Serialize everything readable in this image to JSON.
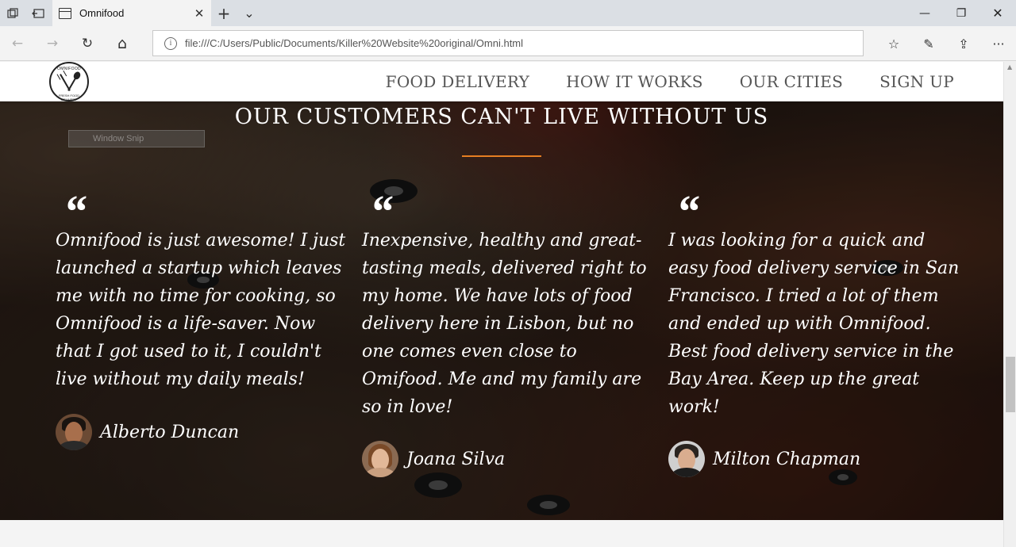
{
  "browser": {
    "tab_title": "Omnifood",
    "url": "file:///C:/Users/Public/Documents/Killer%20Website%20original/Omni.html",
    "icons": {
      "tab_actions": "tab-actions-icon",
      "set_aside": "set-aside-tabs-icon",
      "new_tab": "+",
      "tab_list": "⌄",
      "close_tab": "✕",
      "minimize": "—",
      "restore": "❐",
      "close_window": "✕",
      "back": "←",
      "forward": "→",
      "refresh": "↻",
      "home": "⌂",
      "info": "i",
      "favorites": "☆",
      "notes": "✎",
      "share": "⇪",
      "more": "···"
    }
  },
  "nav": {
    "logo_label": "OMNIFOOD",
    "logo_sub": "FRESH FOOD DELIVERY",
    "links": [
      "FOOD DELIVERY",
      "HOW IT WORKS",
      "OUR CITIES",
      "SIGN UP"
    ]
  },
  "overlay": {
    "snip_label": "Window Snip"
  },
  "section": {
    "title": "OUR CUSTOMERS CAN'T LIVE WITHOUT US",
    "accent_color": "#e67e22",
    "quote_mark": "“",
    "testimonials": [
      {
        "text": "Omnifood is just awesome! I just launched a startup which leaves me with no time for cooking, so Omnifood is a life-saver. Now that I got used to it, I couldn't live without my daily meals!",
        "author": "Alberto Duncan"
      },
      {
        "text": "Inexpensive, healthy and great-tasting meals, delivered right to my home. We have lots of food delivery here in Lisbon, but no one comes even close to Omifood. Me and my family are so in love!",
        "author": "Joana Silva"
      },
      {
        "text": "I was looking for a quick and easy food delivery service in San Francisco. I tried a lot of them and ended up with Omnifood. Best food delivery service in the Bay Area. Keep up the great work!",
        "author": "Milton Chapman"
      }
    ]
  }
}
